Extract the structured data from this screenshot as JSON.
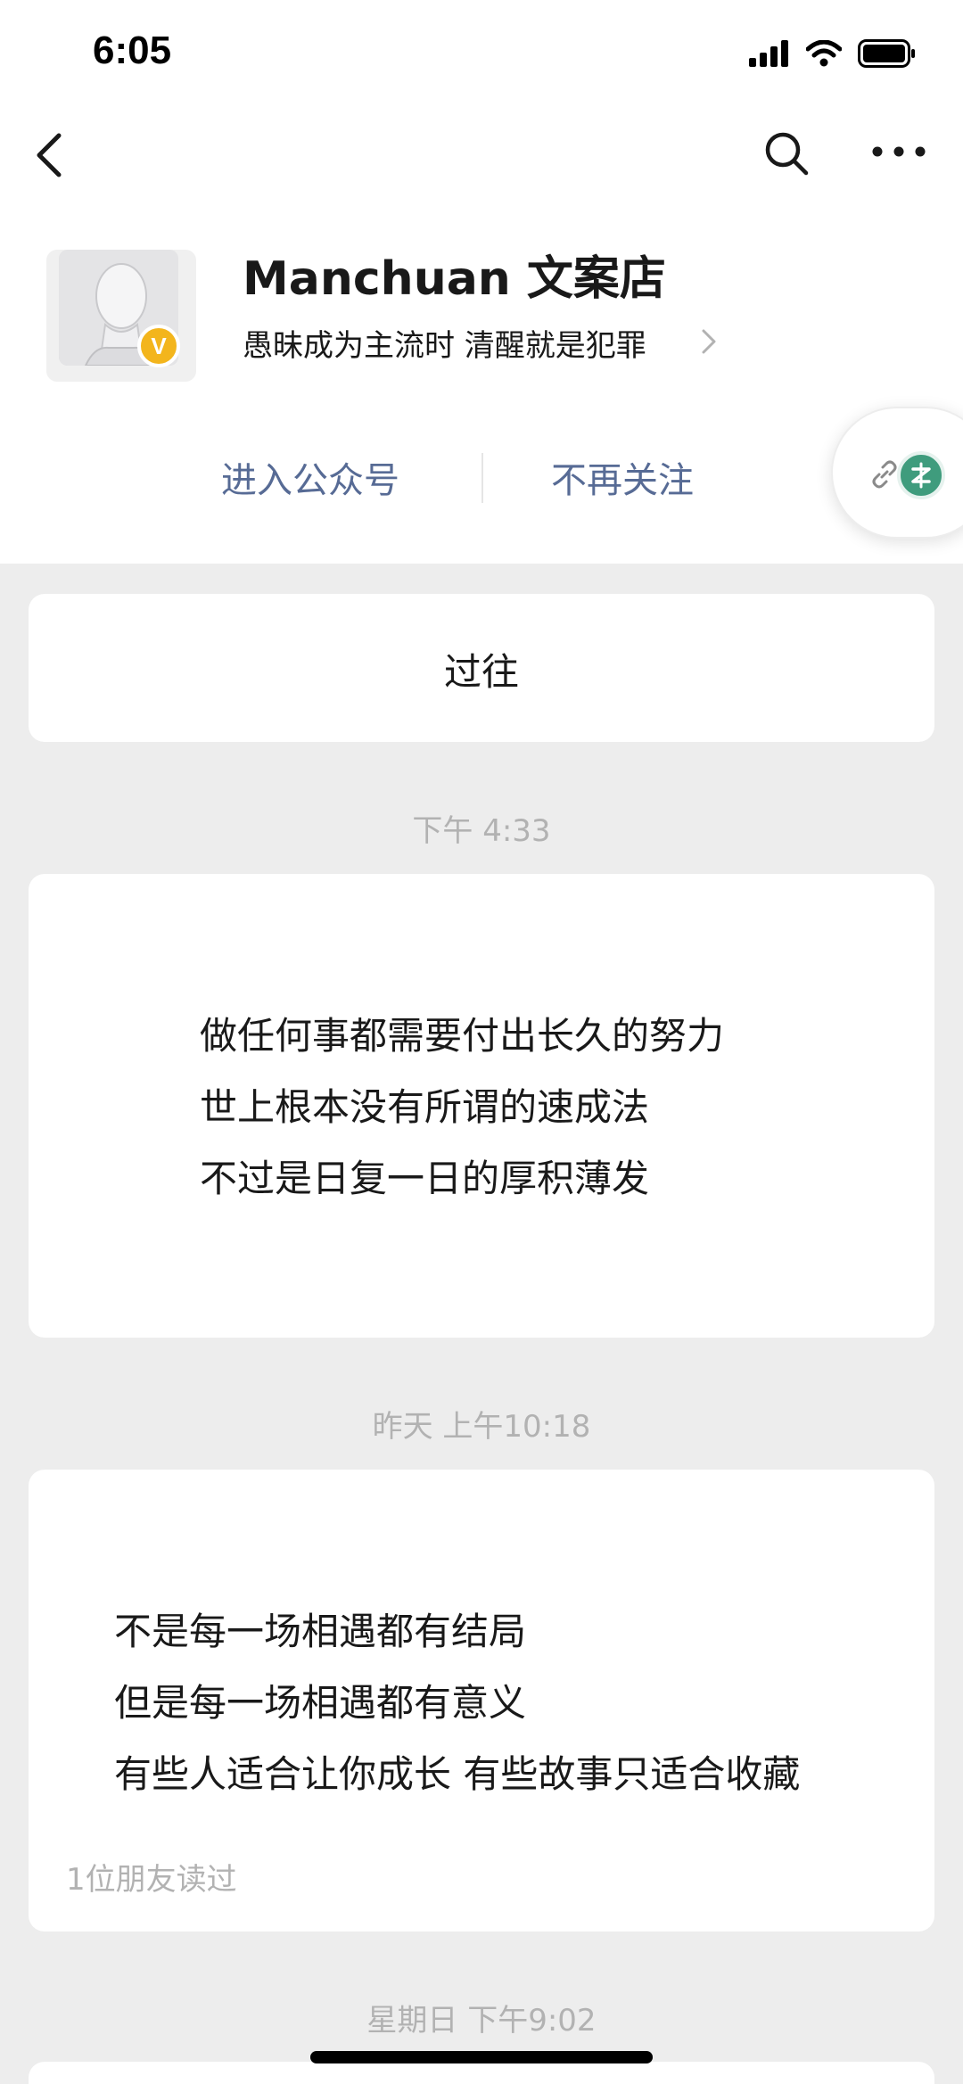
{
  "status_bar": {
    "time": "6:05",
    "icons": [
      "cellular-signal-icon",
      "wifi-icon",
      "battery-icon"
    ]
  },
  "nav": {
    "icons": [
      "back-arrow-icon",
      "search-icon",
      "more-icon"
    ]
  },
  "profile": {
    "name": "Manchuan 文案店",
    "bio": "愚昧成为主流时 清醒就是犯罪",
    "verified_badge": "V",
    "verified_color": "#f3b51c"
  },
  "actions": {
    "enter": "进入公众号",
    "unfollow": "不再关注",
    "color": "#576b95"
  },
  "past_card": {
    "label": "过往"
  },
  "messages": [
    {
      "time": "下午 4:33",
      "lines": [
        "做任何事都需要付出长久的努力",
        "世上根本没有所谓的速成法",
        "不过是日复一日的厚积薄发"
      ]
    },
    {
      "time": "昨天 上午10:18",
      "lines": [
        "不是每一场相遇都有结局",
        "但是每一场相遇都有意义",
        "有些人适合让你成长 有些故事只适合收藏"
      ],
      "read_count": "1位朋友读过"
    },
    {
      "time": "星期日 下午9:02"
    }
  ]
}
